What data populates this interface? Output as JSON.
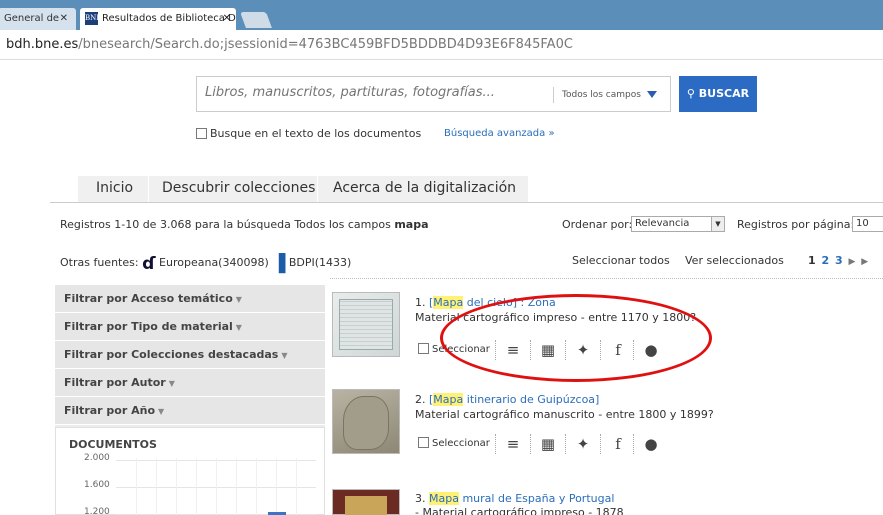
{
  "browser": {
    "tabs": [
      {
        "label": "General de"
      },
      {
        "label": "Resultados de Biblioteca D",
        "icon": "BNE"
      }
    ],
    "url_domain": "bdh.bne.es",
    "url_path": "/bnesearch/Search.do;jsessionid=4763BC459BFD5BDDBD4D93E6F845FA0C"
  },
  "search": {
    "placeholder": "Libros, manuscritos, partituras, fotografías...",
    "field_selected": "Todos los campos",
    "button_label": "BUSCAR",
    "fulltext_checkbox_label": "Busque en el texto de los documentos",
    "advanced_link": "Búsqueda avanzada »"
  },
  "nav": {
    "tabs": [
      "Inicio",
      "Descubrir colecciones",
      "Acerca de la digitalización"
    ]
  },
  "results_header": {
    "records_text": "Registros 1-10 de 3.068 para la búsqueda Todos los campos ",
    "query": "mapa",
    "order_label": "Ordenar por:",
    "order_value": "Relevancia",
    "per_page_label": "Registros por página:",
    "per_page_value": "10",
    "other_sources_label": "Otras fuentes:",
    "europeana": "Europeana(340098)",
    "bdpi": "BDPI(1433)",
    "select_all": "Seleccionar todos",
    "view_selected": "Ver seleccionados",
    "pages": [
      "1",
      "2",
      "3"
    ]
  },
  "filters": [
    "Filtrar por Acceso temático",
    "Filtrar por Tipo de material",
    "Filtrar por Colecciones destacadas",
    "Filtrar por Autor",
    "Filtrar por Año"
  ],
  "chart": {
    "title": "DOCUMENTOS",
    "yticks": [
      "2.000",
      "1.600",
      "1.200"
    ]
  },
  "results": [
    {
      "num": "1.",
      "pre": "[",
      "highlight": "Mapa",
      "title": " del cielo] : Zona",
      "desc": "Material cartográfico impreso  -  entre 1170 y 1800?"
    },
    {
      "num": "2.",
      "pre": "[",
      "highlight": "Mapa",
      "title": " itinerario de Guipúzcoa]",
      "desc": "Material cartográfico manuscrito  -  entre 1800 y 1899?"
    },
    {
      "num": "3.",
      "pre": "",
      "highlight": "Mapa",
      "title": " mural de España y Portugal",
      "desc": "-  Material cartográfico impreso  -  1878"
    }
  ],
  "action_labels": {
    "select": "Seleccionar"
  },
  "colors": {
    "accent": "#2b6bc4",
    "annotation": "#e01010",
    "highlight": "#fff176"
  }
}
